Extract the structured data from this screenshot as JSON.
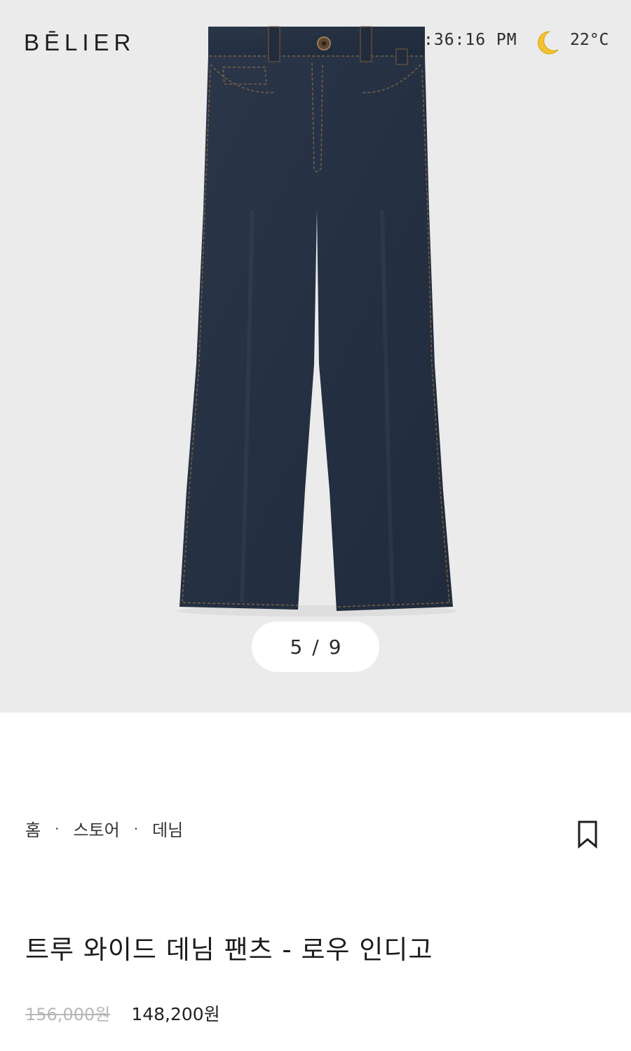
{
  "brand": {
    "logo_text": "BĒLIER"
  },
  "status_bar": {
    "time": ":36:16 PM",
    "weather_icon": "moon-icon",
    "temperature": "22°C"
  },
  "gallery": {
    "current": "5",
    "separator": "/",
    "total": "9",
    "image_subject": "jeans-product-image"
  },
  "breadcrumb": {
    "items": [
      "홈",
      "스토어",
      "데님"
    ],
    "separator": "·"
  },
  "bookmark": {
    "icon": "bookmark-icon"
  },
  "product": {
    "title": "트루 와이드 데님 팬츠 - 로우 인디고",
    "price_original": "156,000원",
    "price_sale": "148,200원"
  },
  "colors": {
    "hero_bg": "#ebebeb",
    "denim": "#253043",
    "stitch": "#a0784a"
  }
}
